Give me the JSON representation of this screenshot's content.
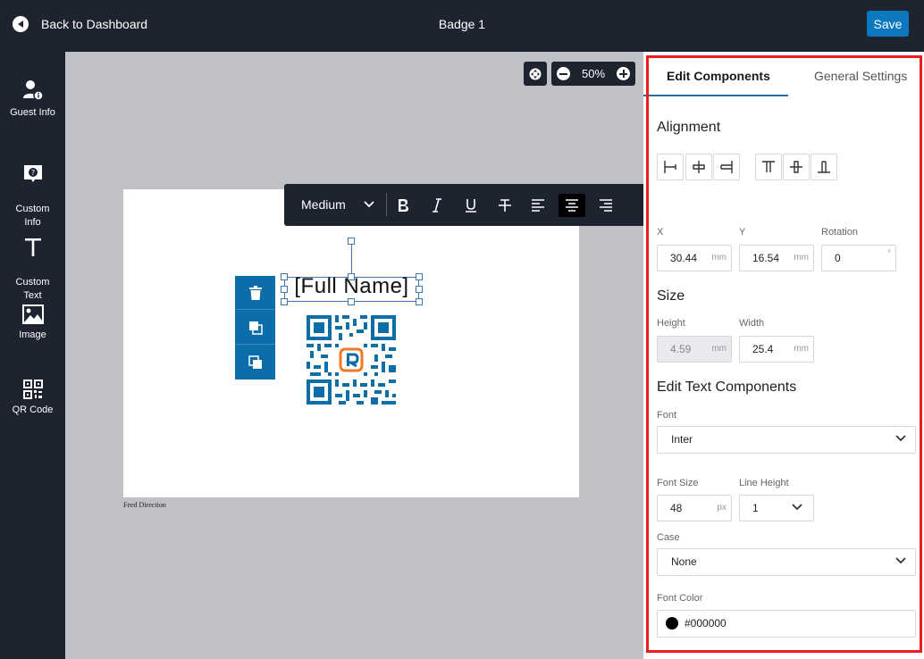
{
  "header": {
    "back_label": "Back to Dashboard",
    "title": "Badge 1",
    "save_label": "Save"
  },
  "sidebar": {
    "items": [
      {
        "label": "Guest Info",
        "icon": "guest-info-icon"
      },
      {
        "label": "Custom\nInfo",
        "icon": "custom-info-icon"
      },
      {
        "label": "Custom\nText",
        "icon": "custom-text-icon"
      },
      {
        "label": "Image",
        "icon": "image-icon"
      },
      {
        "label": "QR Code",
        "icon": "qr-code-icon"
      }
    ]
  },
  "canvas": {
    "zoom": "50%",
    "feed_direction": "Feed Direction",
    "selected_text": "[Full Name]"
  },
  "text_toolbar": {
    "font_weight": "Medium",
    "active_alignment": "center"
  },
  "panel": {
    "tabs": [
      "Edit Components",
      "General Settings"
    ],
    "active_tab": "Edit Components",
    "alignment_title": "Alignment",
    "position": {
      "x_label": "X",
      "x_value": "30.44",
      "x_unit": "mm",
      "y_label": "Y",
      "y_value": "16.54",
      "y_unit": "mm",
      "rotation_label": "Rotation",
      "rotation_value": "0",
      "rotation_unit": "°"
    },
    "size": {
      "title": "Size",
      "height_label": "Height",
      "height_value": "4.59",
      "height_unit": "mm",
      "width_label": "Width",
      "width_value": "25.4",
      "width_unit": "mm"
    },
    "text": {
      "title": "Edit Text Components",
      "font_label": "Font",
      "font_value": "Inter",
      "font_size_label": "Font Size",
      "font_size_value": "48",
      "font_size_unit": "px",
      "line_height_label": "Line Height",
      "line_height_value": "1",
      "case_label": "Case",
      "case_value": "None",
      "color_label": "Font Color",
      "color_value": "#000000"
    }
  },
  "colors": {
    "dark": "#1e2330",
    "accent": "#0b78c0",
    "highlight_border": "#e8201c",
    "qr_blue": "#0b6ea8",
    "qr_orange": "#f07a24"
  }
}
